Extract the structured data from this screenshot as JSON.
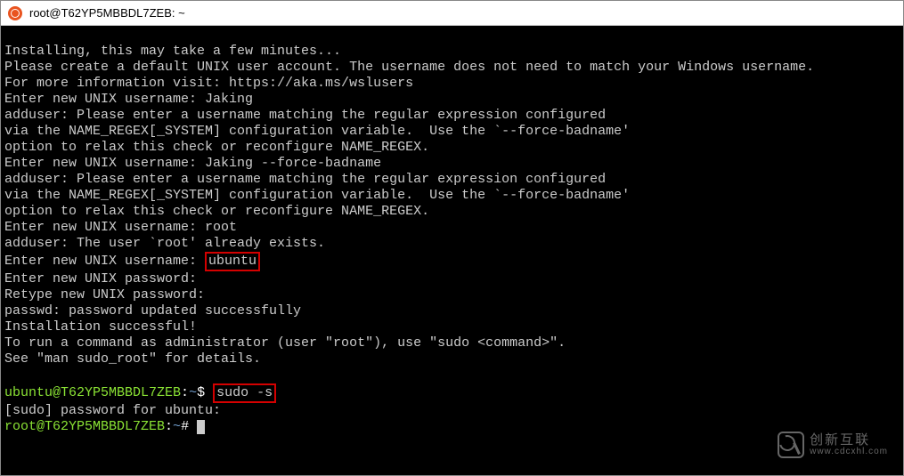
{
  "window": {
    "title": "root@T62YP5MBBDL7ZEB: ~"
  },
  "terminal": {
    "lines": [
      "Installing, this may take a few minutes...",
      "Please create a default UNIX user account. The username does not need to match your Windows username.",
      "For more information visit: https://aka.ms/wslusers",
      "Enter new UNIX username: Jaking",
      "adduser: Please enter a username matching the regular expression configured",
      "via the NAME_REGEX[_SYSTEM] configuration variable.  Use the `--force-badname'",
      "option to relax this check or reconfigure NAME_REGEX.",
      "Enter new UNIX username: Jaking --force-badname",
      "adduser: Please enter a username matching the regular expression configured",
      "via the NAME_REGEX[_SYSTEM] configuration variable.  Use the `--force-badname'",
      "option to relax this check or reconfigure NAME_REGEX.",
      "Enter new UNIX username: root",
      "adduser: The user `root' already exists."
    ],
    "username_prompt": "Enter new UNIX username: ",
    "username_value": "ubuntu",
    "after_username": [
      "Enter new UNIX password:",
      "Retype new UNIX password:",
      "passwd: password updated successfully",
      "Installation successful!",
      "To run a command as administrator (user \"root\"), use \"sudo <command>\".",
      "See \"man sudo_root\" for details.",
      ""
    ],
    "prompt1": {
      "user": "ubuntu@T62YP5MBBDL7ZEB",
      "sep": ":",
      "path": "~",
      "dollar": "$ ",
      "cmd": "sudo -s"
    },
    "sudo_line": "[sudo] password for ubuntu:",
    "prompt2": {
      "user": "root@T62YP5MBBDL7ZEB",
      "sep": ":",
      "path": "~",
      "hash": "# "
    }
  },
  "watermark": {
    "text": "创新互联",
    "url": "www.cdcxhl.com"
  }
}
